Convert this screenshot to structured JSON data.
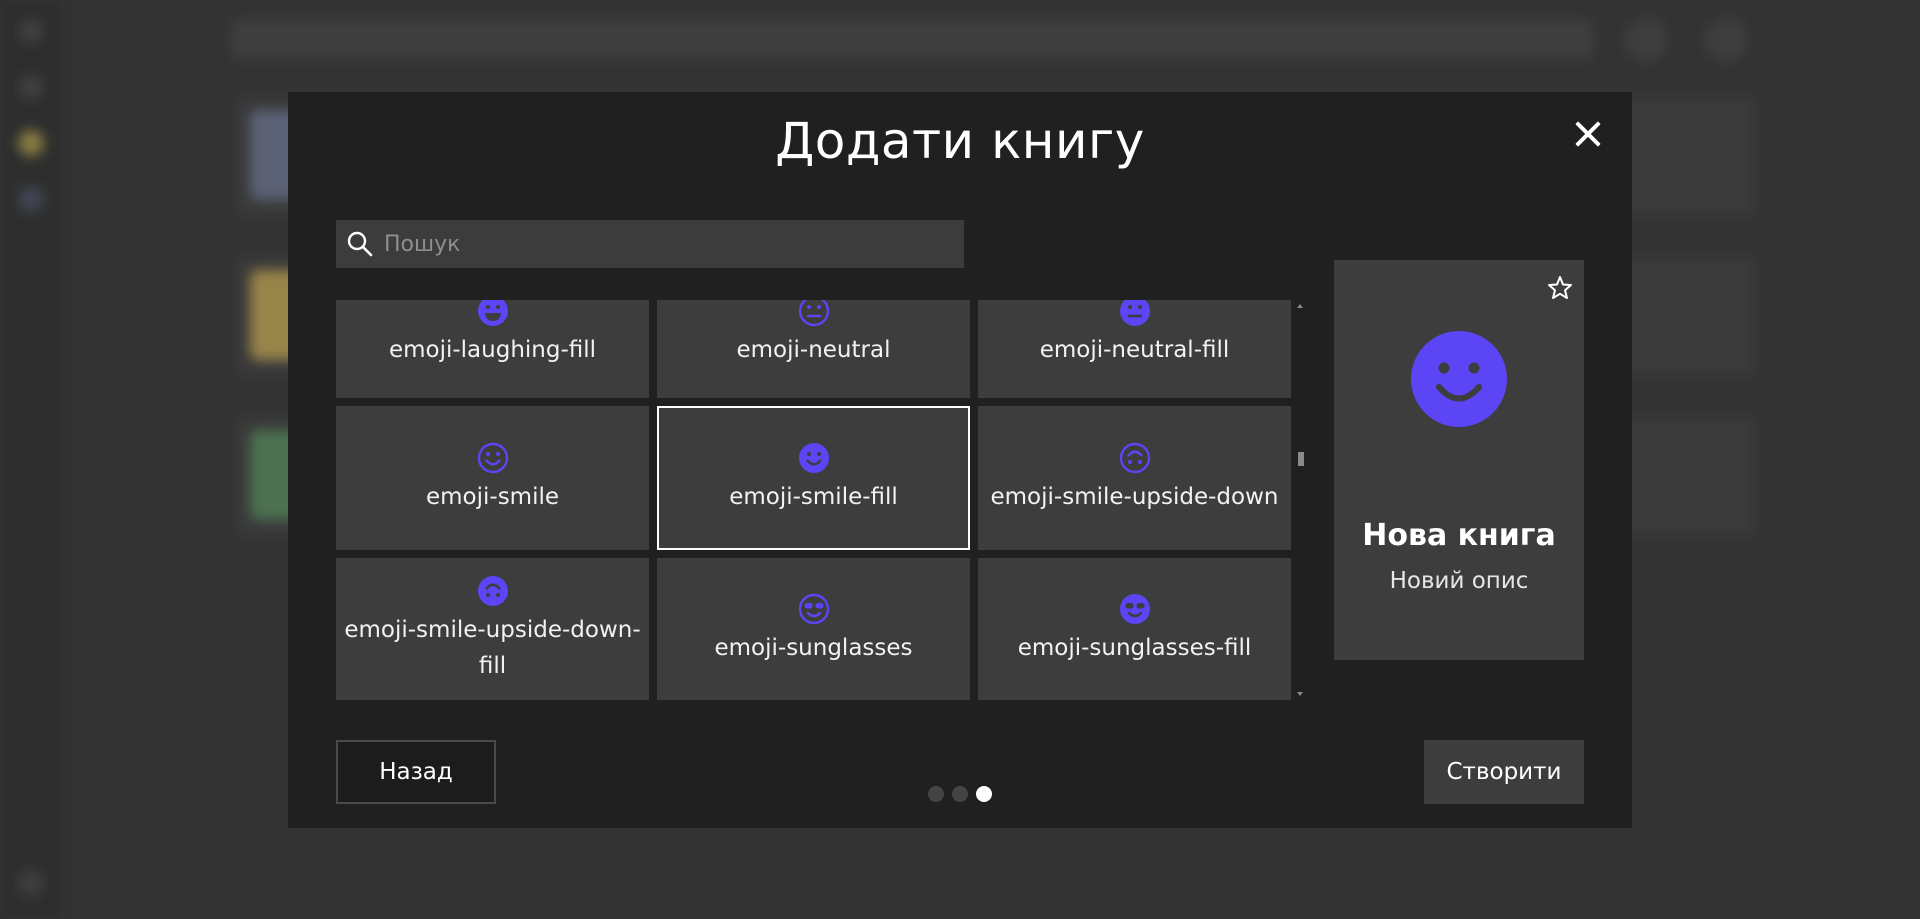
{
  "dialog": {
    "title": "Додати книгу",
    "search_placeholder": "Пошук",
    "back_label": "Назад",
    "create_label": "Створити"
  },
  "icon_grid": {
    "items": [
      {
        "label": "emoji-laughing-fill",
        "icon": "emoji-laughing-fill-icon"
      },
      {
        "label": "emoji-neutral",
        "icon": "emoji-neutral-icon"
      },
      {
        "label": "emoji-neutral-fill",
        "icon": "emoji-neutral-fill-icon"
      },
      {
        "label": "emoji-smile",
        "icon": "emoji-smile-icon"
      },
      {
        "label": "emoji-smile-fill",
        "icon": "emoji-smile-fill-icon",
        "selected": true
      },
      {
        "label": "emoji-smile-upside-down",
        "icon": "emoji-smile-upside-down-icon"
      },
      {
        "label": "emoji-smile-upside-down-fill",
        "icon": "emoji-smile-upside-down-fill-icon"
      },
      {
        "label": "emoji-sunglasses",
        "icon": "emoji-sunglasses-icon"
      },
      {
        "label": "emoji-sunglasses-fill",
        "icon": "emoji-sunglasses-fill-icon"
      }
    ]
  },
  "preview": {
    "title": "Нова книга",
    "description": "Новий опис",
    "icon": "emoji-smile-fill-icon",
    "favorite_icon": "star-icon"
  },
  "pagination": {
    "pages": 3,
    "active_index": 2
  },
  "colors": {
    "accent": "#5b45f5",
    "modal_bg": "#202020",
    "tile_bg": "#3d3d3d"
  }
}
